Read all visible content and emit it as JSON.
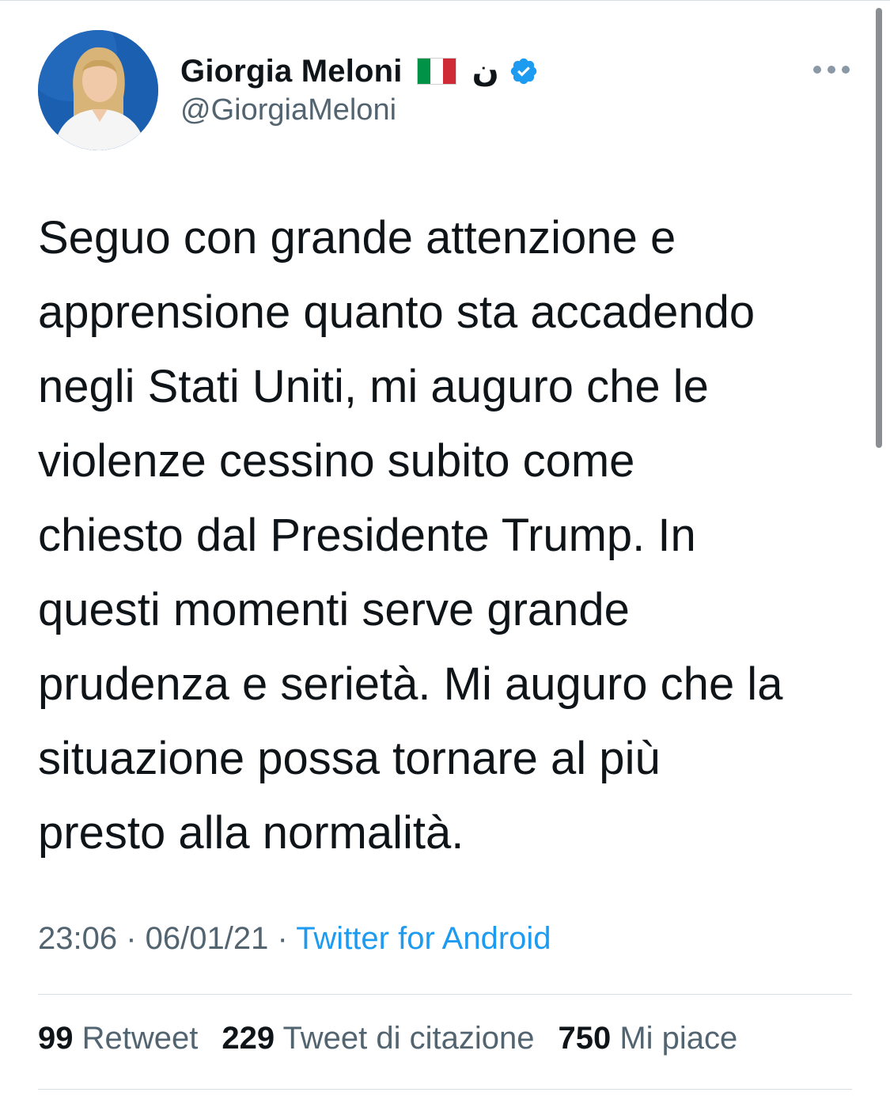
{
  "author": {
    "display_name": "Giorgia Meloni",
    "arabic_letter": "ن",
    "handle": "@GiorgiaMeloni",
    "flag": "italy-flag-emoji",
    "verified_icon": "verified-badge-icon"
  },
  "tweet": {
    "lines": [
      "Seguo con grande attenzione e",
      "apprensione quanto sta accadendo",
      "negli Stati Uniti, mi auguro che le",
      "violenze cessino subito come",
      "chiesto dal Presidente Trump. In",
      "questi momenti serve grande",
      "prudenza e serietà. Mi auguro che la",
      "situazione possa tornare al più",
      "presto alla normalità."
    ]
  },
  "meta": {
    "time": "23:06",
    "separator": " · ",
    "date": "06/01/21",
    "source": "Twitter for Android"
  },
  "stats": {
    "retweets": {
      "count": "99",
      "label": "Retweet"
    },
    "quotes": {
      "count": "229",
      "label": "Tweet di citazione"
    },
    "likes": {
      "count": "750",
      "label": "Mi piace"
    }
  },
  "colors": {
    "accent": "#1d9bf0",
    "secondary_text": "#536471",
    "flag_green": "#009246",
    "flag_white": "#ffffff",
    "flag_red": "#ce2b37"
  }
}
